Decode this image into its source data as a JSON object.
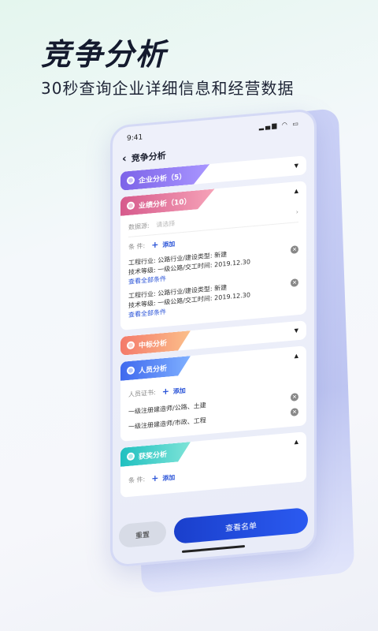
{
  "hero": {
    "title": "竞争分析",
    "subtitle": "30秒查询企业详细信息和经营数据"
  },
  "status": {
    "time": "9:41",
    "icons": "▂▄▆ ◠ ▭"
  },
  "nav": {
    "back_icon": "‹",
    "title": "竞争分析"
  },
  "sections": [
    {
      "label": "企业分析（5）"
    },
    {
      "label": "业绩分析（10）"
    },
    {
      "label": "中标分析"
    },
    {
      "label": "人员分析"
    },
    {
      "label": "获奖分析"
    }
  ],
  "performance": {
    "source_label": "数据源:",
    "source_placeholder": "请选择",
    "cond_label": "条    件:",
    "add_label": "添加",
    "entries": [
      {
        "line1": "工程行业: 公路行业/建设类型: 新建",
        "line2": "技术等级: 一级公路/交工时间: 2019.12.30",
        "link": "查看全部条件"
      },
      {
        "line1": "工程行业: 公路行业/建设类型: 新建",
        "line2": "技术等级: 一级公路/交工时间: 2019.12.30",
        "link": "查看全部条件"
      }
    ]
  },
  "personnel": {
    "cert_label": "人员证书:",
    "add_label": "添加",
    "items": [
      "一级注册建造师/公路、土建",
      "一级注册建造师/市政、工程"
    ]
  },
  "awards": {
    "cond_label": "条    件:",
    "add_label": "添加"
  },
  "footer": {
    "reset": "重置",
    "view": "查看名单"
  }
}
